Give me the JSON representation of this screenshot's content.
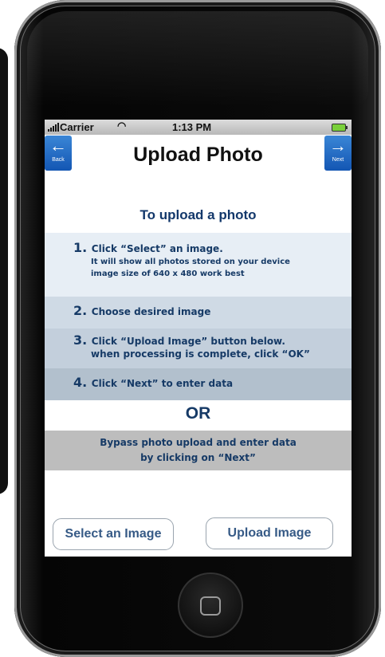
{
  "status_bar": {
    "carrier": "Carrier",
    "time": "1:13 PM",
    "wifi_icon": "wifi-icon",
    "signal_icon": "signal-icon",
    "battery_icon": "battery-icon"
  },
  "nav": {
    "title": "Upload Photo",
    "back_label": "Back",
    "back_icon": "arrow-left-icon",
    "next_label": "Next",
    "next_icon": "arrow-right-icon"
  },
  "instructions": {
    "heading": "To upload a photo",
    "steps": [
      {
        "number": "1.",
        "text": "Click “Select” an image.",
        "details": [
          "It will show all photos stored on your device",
          "image size of 640 x 480 work best"
        ]
      },
      {
        "number": "2.",
        "text": "Choose desired image"
      },
      {
        "number": "3.",
        "text": "Click “Upload Image” button below.",
        "continuation": "when processing is complete, click “OK”"
      },
      {
        "number": "4.",
        "text": "Click “Next” to enter data"
      }
    ]
  },
  "or_label": "OR",
  "bypass": {
    "line1": "Bypass photo upload and enter data",
    "line2": "by clicking on “Next”"
  },
  "buttons": {
    "select_image": "Select an Image",
    "upload_image": "Upload Image"
  },
  "colors": {
    "nav_button_blue": "#1356b3",
    "text_navy": "#163a66",
    "button_text": "#365a86",
    "battery_green": "#7ad03a"
  }
}
